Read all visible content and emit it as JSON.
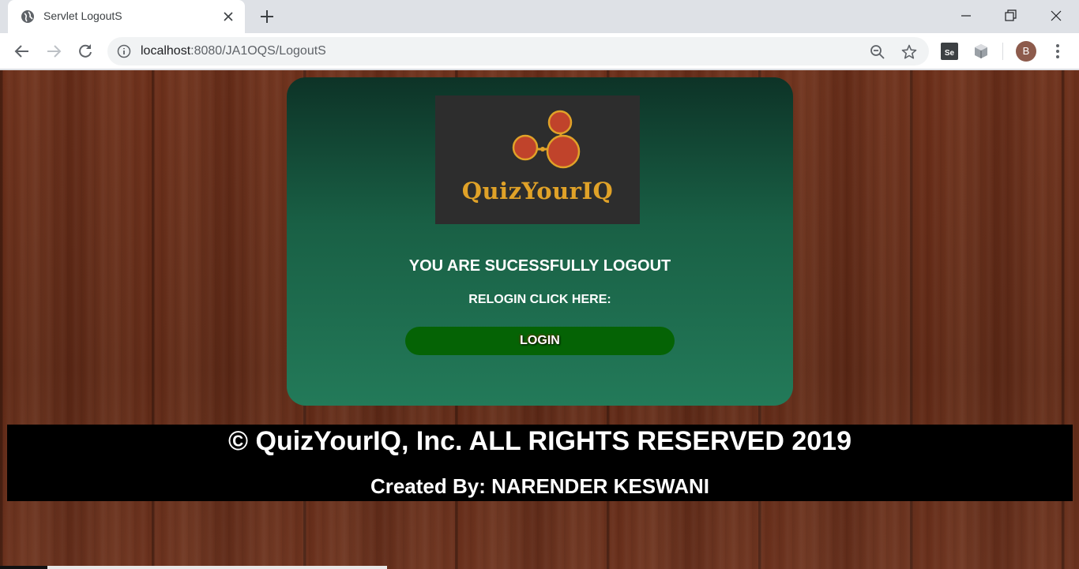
{
  "browser": {
    "tab_title": "Servlet LogoutS",
    "url_host": "localhost",
    "url_path": ":8080/JA1OQS/LogoutS",
    "avatar_letter": "B",
    "extension_label": "Se"
  },
  "card": {
    "logo_text": "QuizYourIQ",
    "message": "YOU ARE SUCESSFULLY LOGOUT",
    "relogin_text": "RELOGIN CLICK HERE:",
    "login_button": "LOGIN"
  },
  "footer": {
    "copyright": "© QuizYourIQ, Inc. ALL RIGHTS RESERVED 2019",
    "created_by": "Created By: NARENDER KESWANI"
  },
  "colors": {
    "card_top": "#0d3327",
    "card_bottom": "#237a59",
    "login_button": "#056305",
    "logo_gold": "#e0a228",
    "logo_node": "#c0432b"
  }
}
